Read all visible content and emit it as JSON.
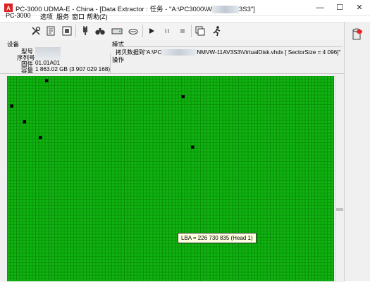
{
  "window": {
    "title_prefix": "PC-3000 UDMA-E - China - [Data Extractor : 任务 - \"A:\\PC3000\\W",
    "title_suffix": "3S3\"]",
    "min_label": "—",
    "max_label": "☐",
    "close_label": "✕"
  },
  "menu": [
    "PC-3000",
    "选项",
    "服务",
    "窗口",
    "帮助(Z)"
  ],
  "device": {
    "section_title": "设备",
    "model_label": "型号",
    "serial_label": "序列号",
    "firmware_label": "固件",
    "firmware_value": "01.01A01",
    "capacity_label": "容量",
    "capacity_value": "1 863.02 GB (3 907 029 168)"
  },
  "mode": {
    "section_title": "模式",
    "copy_prefix": "拷贝数据到\"A:\\PC",
    "copy_suffix": "NMVW-11AV3S3\\VirtualDisk.vhdx [ SectorSize = 4 096]\"",
    "operation_title": "操作"
  },
  "toolbar_icons": [
    "tools-icon",
    "document-icon",
    "chip-icon",
    "plug-icon",
    "binoculars-icon",
    "drive-icon",
    "cloud-icon",
    "play-icon",
    "pause-icon",
    "stop-icon",
    "copy-icon",
    "run-icon"
  ],
  "tooltip": {
    "text": "LBA =  226 730 835 (Head 1)"
  },
  "grid": {
    "fill_color": "#0fb30f",
    "line_color": "#0b7a0b",
    "bad_color": "#000000",
    "bad_blocks": [
      [
        12,
        1
      ],
      [
        55,
        6
      ],
      [
        1,
        9
      ],
      [
        5,
        14
      ],
      [
        10,
        19
      ],
      [
        58,
        22
      ]
    ]
  }
}
